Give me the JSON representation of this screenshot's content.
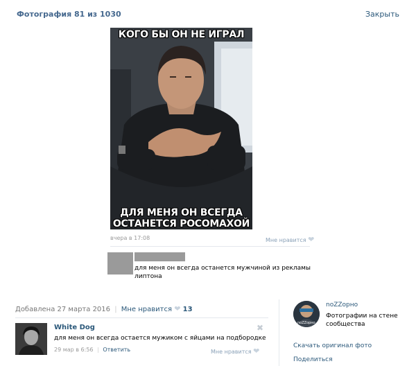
{
  "header": {
    "photo_counter": "Фотография 81 из 1030",
    "close_label": "Закрыть"
  },
  "photo": {
    "caption_top": "КОГО БЫ ОН НЕ ИГРАЛ",
    "caption_bottom_line1": "ДЛЯ МЕНЯ ОН ВСЕГДА",
    "caption_bottom_line2": "ОСТАНЕТСЯ РОСОМАХОЙ",
    "time": "вчера в 17:08",
    "like_label": "Мне нравится"
  },
  "inner_comment": {
    "text": "для меня он всегда останется мужчиной из рекламы липтона"
  },
  "post_meta": {
    "added": "Добавлена 27 марта 2016",
    "separator": "|",
    "like_label": "Мне нравится",
    "like_count": "13"
  },
  "comments": [
    {
      "author": "White Dog",
      "text": "для меня он всегда остается мужиком с яйцами на подбородке",
      "date": "29 мар в 6:56",
      "separator": "|",
      "reply_label": "Ответить",
      "like_label": "Мне нравится"
    }
  ],
  "owner": {
    "name": "noZZорно",
    "description": "Фотографии на стене сообщества",
    "avatar_text": "noZZорно"
  },
  "actions": {
    "original_label": "Скачать оригинал фото",
    "share_label": "Поделиться"
  },
  "icons": {
    "heart": "heart-icon",
    "close": "close-icon"
  },
  "colors": {
    "link": "#2b587a",
    "title": "#45688e",
    "meta": "#777777",
    "heart": "#c8d3de"
  }
}
